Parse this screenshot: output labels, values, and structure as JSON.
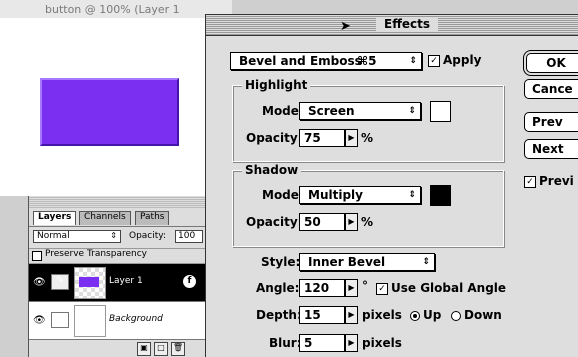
{
  "document": {
    "title": "button @ 100% (Layer 1"
  },
  "layers_palette": {
    "tabs": [
      "Layers",
      "Channels",
      "Paths"
    ],
    "blend_mode": "Normal",
    "opacity_label": "Opacity:",
    "opacity_value": "100",
    "preserve_transparency": "Preserve Transparency",
    "layers": [
      {
        "name": "Layer 1",
        "selected": true
      },
      {
        "name": "Background",
        "selected": false
      }
    ]
  },
  "effects_dialog": {
    "title": "Effects",
    "effect_popup": "Bevel and Emboss",
    "effect_shortcut": "⌘5",
    "apply_label": "Apply",
    "apply_checked": true,
    "highlight": {
      "title": "Highlight",
      "mode_label": "Mode:",
      "mode_value": "Screen",
      "opacity_label": "Opacity:",
      "opacity_value": "75",
      "unit": "%",
      "color": "#ffffff"
    },
    "shadow": {
      "title": "Shadow",
      "mode_label": "Mode:",
      "mode_value": "Multiply",
      "opacity_label": "Opacity:",
      "opacity_value": "50",
      "unit": "%",
      "color": "#000000"
    },
    "style_label": "Style:",
    "style_value": "Inner Bevel",
    "angle_label": "Angle:",
    "angle_value": "120",
    "angle_unit": "°",
    "global_angle_label": "Use Global Angle",
    "global_angle_checked": true,
    "depth_label": "Depth:",
    "depth_value": "15",
    "depth_unit": "pixels",
    "up_label": "Up",
    "down_label": "Down",
    "direction": "Up",
    "blur_label": "Blur:",
    "blur_value": "5",
    "blur_unit": "pixels",
    "buttons": {
      "ok": "OK",
      "cancel": "Cance",
      "prev": "Prev",
      "next": "Next"
    },
    "preview_label": "Previ",
    "preview_checked": true
  },
  "colors": {
    "button_fill": "#7b2ff0",
    "selected_layer": "#000000"
  }
}
